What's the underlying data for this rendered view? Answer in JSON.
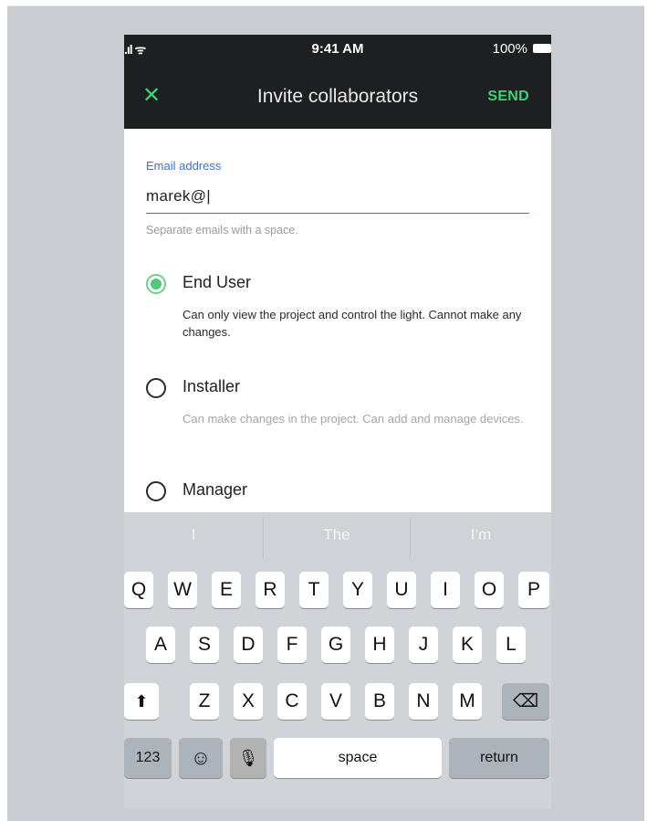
{
  "status_bar": {
    "signal": ".ıl ᯤ",
    "time": "9:41 AM",
    "battery": "100%"
  },
  "nav": {
    "close_icon": "✕",
    "title": "Invite collaborators",
    "send_label": "SEND"
  },
  "email": {
    "label": "Email address",
    "value": "marek@|",
    "helper": "Separate emails with a space."
  },
  "roles": [
    {
      "name": "End User",
      "description": "Can only view the project and control the light. Cannot make any changes.",
      "selected": true
    },
    {
      "name": "Installer",
      "description": "Can make changes in the project. Can add and manage devices.",
      "selected": false
    },
    {
      "name": "Manager",
      "description": "",
      "selected": false
    }
  ],
  "suggestions": [
    "I",
    "The",
    "I’m"
  ],
  "keyboard": {
    "row1": [
      "Q",
      "W",
      "E",
      "R",
      "T",
      "Y",
      "U",
      "I",
      "O",
      "P"
    ],
    "row2": [
      "A",
      "S",
      "D",
      "F",
      "G",
      "H",
      "J",
      "K",
      "L"
    ],
    "row3": [
      "Z",
      "X",
      "C",
      "V",
      "B",
      "N",
      "M"
    ],
    "shift": "⬆",
    "backspace": "⌫",
    "numbers": "123",
    "emoji": "☺",
    "mic": "🎙",
    "space": "space",
    "return": "return"
  },
  "colors": {
    "accent_green": "#3fd07a",
    "accent_blue": "#3f6fd8",
    "topbar": "#1e1f20"
  }
}
